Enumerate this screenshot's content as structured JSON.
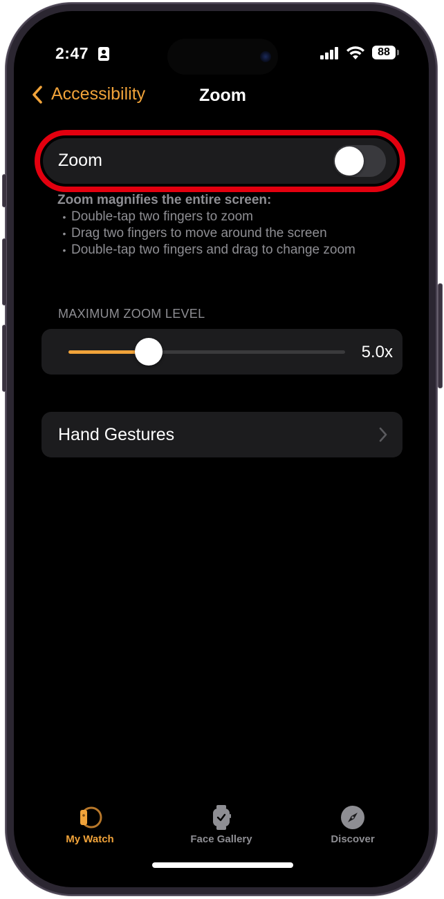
{
  "status_bar": {
    "time": "2:47",
    "battery": "88"
  },
  "nav": {
    "back_label": "Accessibility",
    "title": "Zoom"
  },
  "zoom_toggle": {
    "label": "Zoom",
    "enabled": false
  },
  "footer": {
    "heading": "Zoom magnifies the entire screen:",
    "bullets": [
      "Double-tap two fingers to zoom",
      "Drag two fingers to move around the screen",
      "Double-tap two fingers and drag to change zoom"
    ]
  },
  "max_zoom": {
    "section_header": "MAXIMUM ZOOM LEVEL",
    "value_label": "5.0x",
    "fraction": 0.29
  },
  "hand_gestures": {
    "label": "Hand Gestures"
  },
  "tabbar": {
    "tabs": [
      {
        "label": "My Watch",
        "icon": "watch-side-icon",
        "active": true
      },
      {
        "label": "Face Gallery",
        "icon": "watch-face-icon",
        "active": false
      },
      {
        "label": "Discover",
        "icon": "compass-icon",
        "active": false
      }
    ]
  },
  "colors": {
    "accent": "#f1a33a",
    "highlight": "#e3000f",
    "inactive_tab": "#8e8e93",
    "card": "#1c1c1e"
  }
}
